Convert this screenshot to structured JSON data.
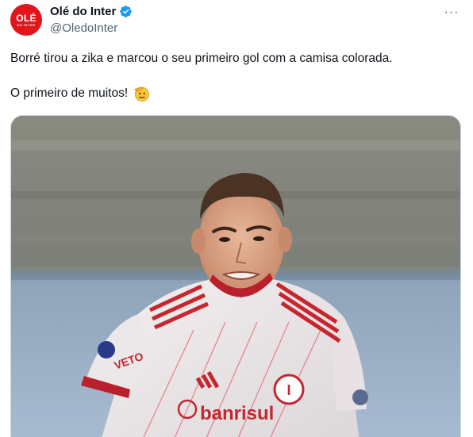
{
  "author": {
    "avatar_text": "OLÉ",
    "avatar_subtext": "DO INTER",
    "display_name": "Olé do Inter",
    "handle": "@OledoInter",
    "verified": true
  },
  "more_menu_label": "···",
  "tweet": {
    "line1": "Borré tirou a zika e marcou o seu primeiro gol com a camisa colorada.",
    "line2": "O primeiro de muitos!",
    "emoji": "saluting-face"
  },
  "media": {
    "jersey_sponsor": "banrisul",
    "jersey_sleeve": "VETO"
  },
  "colors": {
    "brand_red": "#e4141b",
    "verified_blue": "#1d9bf0",
    "secondary_text": "#536471"
  }
}
